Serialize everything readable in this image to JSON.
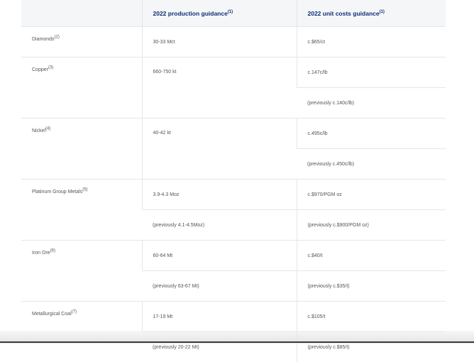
{
  "header": {
    "col1": "",
    "col2": "2022 production guidance",
    "col2_sup": "(1)",
    "col3": "2022 unit costs guidance",
    "col3_sup": "(1)"
  },
  "rows": [
    {
      "metal": "Diamonds",
      "sup": "(2)",
      "production": [
        "30-33 Mct"
      ],
      "costs": [
        "c.$65/ct"
      ]
    },
    {
      "metal": "Copper",
      "sup": "(3)",
      "production": [
        "660-750 kt"
      ],
      "costs": [
        "c.147c/lb",
        "(previously c.140c/lb)"
      ]
    },
    {
      "metal": "Nickel",
      "sup": "(4)",
      "production": [
        "40-42 kt"
      ],
      "costs": [
        "c.495c/lb",
        "(previously c.450c/lb)"
      ]
    },
    {
      "metal": "Platinum Group Metals",
      "sup": "(5)",
      "production": [
        "3.9-4.3 Moz",
        "(previously 4.1-4.5Moz)"
      ],
      "costs": [
        "c.$970/PGM oz",
        "(previously c.$900/PGM oz)"
      ]
    },
    {
      "metal": "Iron Ore",
      "sup": "(6)",
      "production": [
        "60-64 Mt",
        "(previously 63-67 Mt)"
      ],
      "costs": [
        "c.$40/t",
        "(previously c.$35/t)"
      ]
    },
    {
      "metal": "Metallurgical Coal",
      "sup": "(7)",
      "production": [
        "17-19 Mt",
        "(previously 20-22 Mt)"
      ],
      "costs": [
        "c.$105/t",
        "(previously c.$85/t)"
      ]
    }
  ]
}
